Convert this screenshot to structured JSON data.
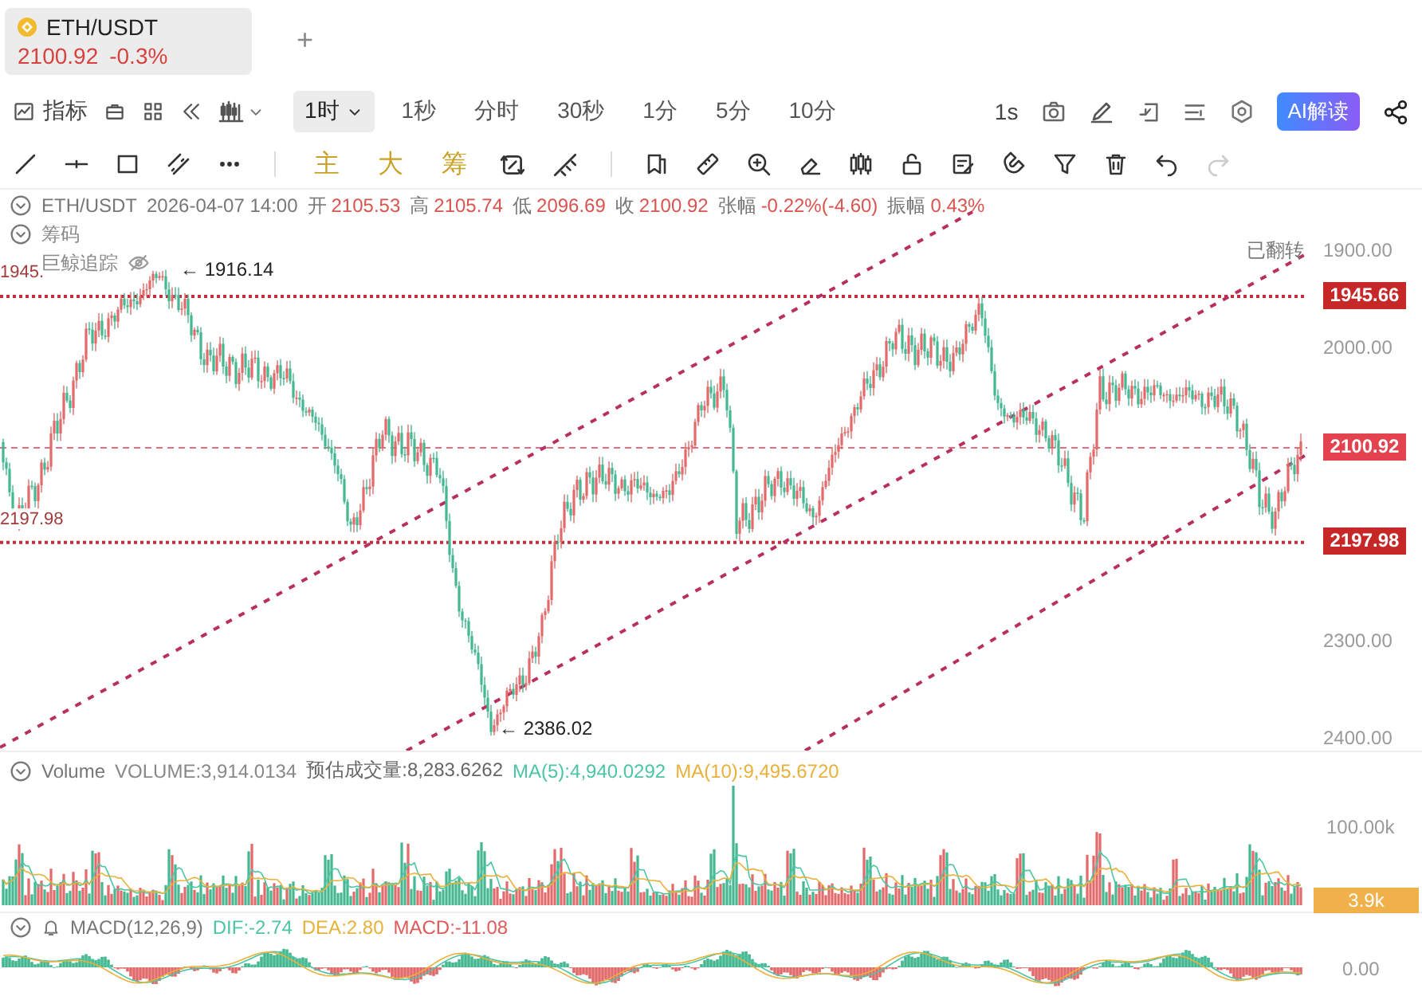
{
  "tab": {
    "symbol": "ETH/USDT",
    "price": "2100.92",
    "change": "-0.3%",
    "add": "+"
  },
  "toolbar": {
    "indicator": "指标",
    "intervals": [
      {
        "label": "1时",
        "selected": true
      },
      {
        "label": "1秒",
        "selected": false
      },
      {
        "label": "分时",
        "selected": false
      },
      {
        "label": "30秒",
        "selected": false
      },
      {
        "label": "1分",
        "selected": false
      },
      {
        "label": "5分",
        "selected": false
      },
      {
        "label": "10分",
        "selected": false
      }
    ],
    "realtime": "1s",
    "ai_button": "AI解读"
  },
  "drawing_toolbar": {
    "presets": [
      "主",
      "大",
      "筹"
    ],
    "history": [
      {
        "kind": "undo",
        "disabled": false
      },
      {
        "kind": "redo",
        "disabled": true
      }
    ]
  },
  "main_chart": {
    "symbol": "ETH/USDT",
    "datetime": "2026-04-07 14:00",
    "fields": [
      {
        "label": "开",
        "value": "2105.53"
      },
      {
        "label": "高",
        "value": "2105.74"
      },
      {
        "label": "低",
        "value": "2096.69"
      },
      {
        "label": "收",
        "value": "2100.92"
      },
      {
        "label": "张幅",
        "value": "-0.22%(-4.60)"
      },
      {
        "label": "振幅",
        "value": "0.43%"
      }
    ],
    "overlays": [
      {
        "label": "筹码",
        "kind": "collapsible"
      },
      {
        "label": "巨鲸追踪",
        "kind": "hideable"
      }
    ],
    "flip_label": "已翻转",
    "annotations": [
      {
        "kind": "high",
        "text": "← 1916.14"
      },
      {
        "kind": "low",
        "text": "← 2386.02"
      }
    ],
    "left_labels": [
      "1945.",
      "2197.98"
    ],
    "y_ticks": [
      "1900.00",
      "2000.00",
      "2300.00",
      "2400.00"
    ],
    "price_tags": [
      {
        "text": "1945.66",
        "kind": "level"
      },
      {
        "text": "2100.92",
        "kind": "last"
      },
      {
        "text": "2197.98",
        "kind": "level"
      }
    ]
  },
  "volume": {
    "legend": [
      {
        "text": "Volume",
        "color": "#777777"
      },
      {
        "text": "VOLUME:3,914.0134",
        "color": "#888888"
      },
      {
        "text": "预估成交量:8,283.6262",
        "color": "#666666"
      },
      {
        "text": "MA(5):4,940.0292",
        "color": "#4cc5a5"
      },
      {
        "text": "MA(10):9,495.6720",
        "color": "#e9b13a"
      }
    ],
    "tick": "100.00k",
    "tag": "3.9k"
  },
  "macd": {
    "legend": [
      {
        "text": "MACD(12,26,9)",
        "color": "#777777"
      },
      {
        "text": "DIF:-2.74",
        "color": "#4cc5a5"
      },
      {
        "text": "DEA:2.80",
        "color": "#e9b13a"
      },
      {
        "text": "MACD:-11.08",
        "color": "#e05a5a"
      }
    ],
    "tick": "0.00"
  }
}
